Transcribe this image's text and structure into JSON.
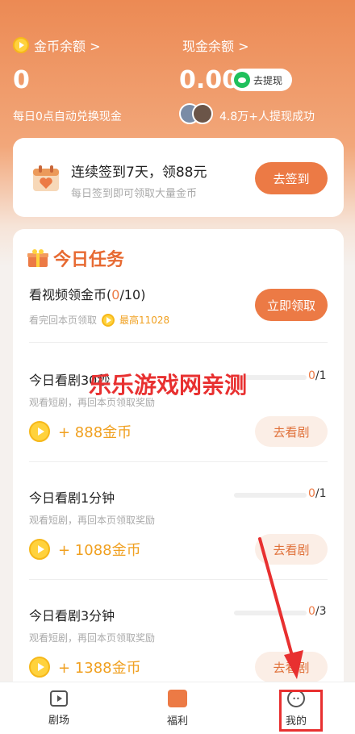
{
  "wallet": {
    "coin_label": "金币余额 >",
    "coin_value": "0",
    "coin_note": "每日0点自动兑换现金",
    "cash_label": "现金余额 >",
    "cash_value": "0.00",
    "withdraw_label": "去提现",
    "withdraw_note": "4.8万+人提现成功"
  },
  "signin": {
    "title": "连续签到7天，领88元",
    "subtitle": "每日签到即可领取大量金币",
    "button": "去签到"
  },
  "tasks": {
    "title": "今日任务",
    "video": {
      "name_prefix": "看视频领金币(",
      "count_current": "0",
      "count_rest": "/10)",
      "sub_prefix": "看完回本页领取",
      "max_label": "最高11028",
      "button": "立即领取"
    },
    "items": [
      {
        "name": "今日看剧30秒",
        "sub": "观看短剧，再回本页领取奖励",
        "cur": "0",
        "total": "/1",
        "progress": 0,
        "reward": "+ 888金币",
        "button": "去看剧"
      },
      {
        "name": "今日看剧1分钟",
        "sub": "观看短剧，再回本页领取奖励",
        "cur": "0",
        "total": "/1",
        "progress": 0,
        "reward": "+ 1088金币",
        "button": "去看剧"
      },
      {
        "name": "今日看剧3分钟",
        "sub": "观看短剧，再回本页领取奖励",
        "cur": "0",
        "total": "/3",
        "progress": 0,
        "reward": "+ 1388金币",
        "button": "去看剧"
      }
    ]
  },
  "watermark": "乐乐游戏网亲测",
  "nav": {
    "theater": "剧场",
    "welfare": "福利",
    "me": "我的"
  },
  "colors": {
    "accent": "#ec7a45",
    "highlight": "#e83030",
    "coin": "#ffd23d"
  }
}
